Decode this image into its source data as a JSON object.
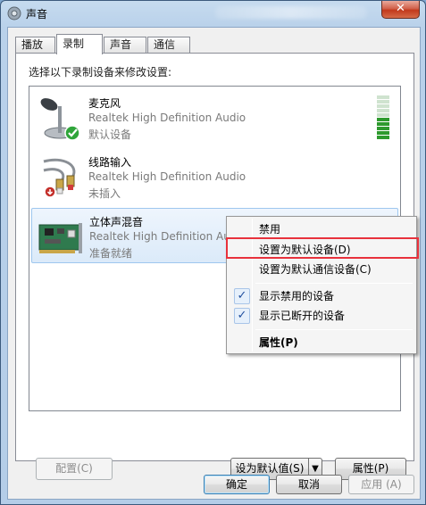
{
  "window": {
    "title": "声音",
    "close_label": "✕"
  },
  "tabs": [
    {
      "label": "播放",
      "active": false
    },
    {
      "label": "录制",
      "active": true
    },
    {
      "label": "声音",
      "active": false
    },
    {
      "label": "通信",
      "active": false
    }
  ],
  "instruction": "选择以下录制设备来修改设置:",
  "devices": [
    {
      "name": "麦克风",
      "description": "Realtek High Definition Audio",
      "status": "默认设备",
      "icon": "microphone-icon"
    },
    {
      "name": "线路输入",
      "description": "Realtek High Definition Audio",
      "status": "未插入",
      "icon": "line-in-cable-icon"
    },
    {
      "name": "立体声混音",
      "description": "Realtek High Definition Audio",
      "status": "准备就绪",
      "icon": "sound-card-icon"
    }
  ],
  "level_meter": {
    "level": 0.5,
    "segments": 10
  },
  "context_menu": {
    "items": [
      {
        "label": "禁用",
        "checked": false,
        "bold": false
      },
      {
        "label": "设置为默认设备(D)",
        "checked": false,
        "bold": false,
        "highlighted": true
      },
      {
        "label": "设置为默认通信设备(C)",
        "checked": false,
        "bold": false
      },
      {
        "label": "显示禁用的设备",
        "checked": true,
        "bold": false
      },
      {
        "label": "显示已断开的设备",
        "checked": true,
        "bold": false
      },
      {
        "label": "属性(P)",
        "checked": false,
        "bold": true
      }
    ],
    "check_glyph": "✓"
  },
  "buttons": {
    "configure": "配置(C)",
    "set_default": "设为默认值(S)",
    "set_default_arrow": "▼",
    "properties": "属性(P)",
    "ok": "确定",
    "cancel": "取消",
    "apply": "应用 (A)"
  },
  "colors": {
    "highlight": "#e8323c",
    "selection": "#dbeaf9",
    "meter_active": "#2e9a2e",
    "meter_inactive": "#cfe3cf"
  }
}
